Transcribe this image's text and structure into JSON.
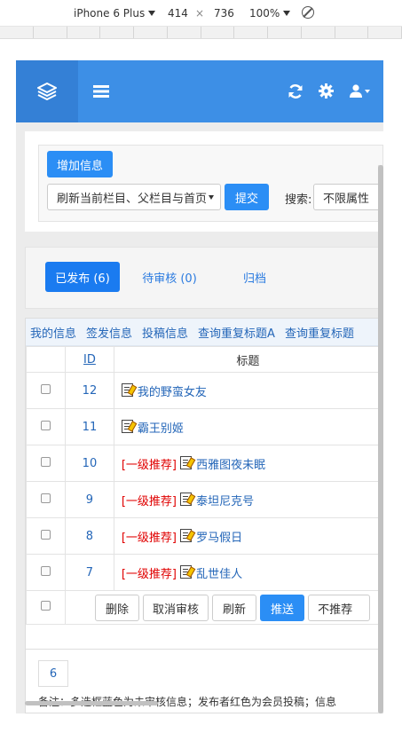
{
  "devtools": {
    "device": "iPhone 6 Plus",
    "width": "414",
    "times": "×",
    "height": "736",
    "zoom": "100%"
  },
  "add_button": "增加信息",
  "refresh_select": "刷新当前栏目、父栏目与首页",
  "submit_button": "提交",
  "search_label": "搜索:",
  "attr_select": "不限属性",
  "tabs": [
    {
      "label": "已发布 (6)"
    },
    {
      "label": "待审核 (0)"
    },
    {
      "label": "归档"
    }
  ],
  "linkbar": [
    "我的信息",
    "签发信息",
    "投稿信息",
    "查询重复标题A",
    "查询重复标题"
  ],
  "table": {
    "header_id": "ID",
    "header_title": "标题",
    "rows": [
      {
        "id": "12",
        "rec": "",
        "title": "我的野蛮女友"
      },
      {
        "id": "11",
        "rec": "",
        "title": "霸王别姬"
      },
      {
        "id": "10",
        "rec": "[一级推荐]",
        "title": "西雅图夜未眠"
      },
      {
        "id": "9",
        "rec": "[一级推荐]",
        "title": "泰坦尼克号"
      },
      {
        "id": "8",
        "rec": "[一级推荐]",
        "title": "罗马假日"
      },
      {
        "id": "7",
        "rec": "[一级推荐]",
        "title": "乱世佳人"
      }
    ]
  },
  "actions": {
    "delete": "删除",
    "cancel_review": "取消审核",
    "refresh": "刷新",
    "push": "推送",
    "recommend_select": "不推荐"
  },
  "pager": "6",
  "note": "备注：多选框蓝色为未审核信息；发布者红色为会员投稿；信息"
}
